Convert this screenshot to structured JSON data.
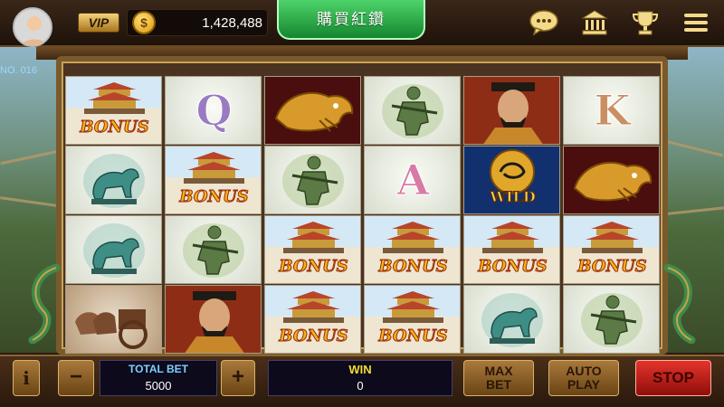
{
  "header": {
    "vip_label": "VIP",
    "coin_symbol": "$",
    "coins": "1,428,488",
    "buy_label": "購買紅鑽",
    "icons": [
      "chat-icon",
      "bank-icon",
      "trophy-icon",
      "menu-icon"
    ]
  },
  "machine": {
    "serial": "NO. 016"
  },
  "reels": [
    [
      {
        "symbol": "bonus-pagoda",
        "label": "BONUS"
      },
      {
        "symbol": "jade-qilin",
        "label": ""
      },
      {
        "symbol": "jade-qilin",
        "label": ""
      },
      {
        "symbol": "terracotta-chariot",
        "label": ""
      }
    ],
    [
      {
        "symbol": "letter-q",
        "label": "Q"
      },
      {
        "symbol": "bonus-pagoda",
        "label": "BONUS"
      },
      {
        "symbol": "jade-archer",
        "label": ""
      },
      {
        "symbol": "emperor",
        "label": ""
      }
    ],
    [
      {
        "symbol": "golden-dragon",
        "label": ""
      },
      {
        "symbol": "jade-archer",
        "label": ""
      },
      {
        "symbol": "bonus-pagoda",
        "label": "BONUS"
      },
      {
        "symbol": "bonus-pagoda",
        "label": "BONUS"
      }
    ],
    [
      {
        "symbol": "jade-archer",
        "label": ""
      },
      {
        "symbol": "letter-a",
        "label": "A"
      },
      {
        "symbol": "bonus-pagoda",
        "label": "BONUS"
      },
      {
        "symbol": "bonus-pagoda",
        "label": "BONUS"
      }
    ],
    [
      {
        "symbol": "emperor",
        "label": ""
      },
      {
        "symbol": "wild",
        "label": "WILD"
      },
      {
        "symbol": "bonus-pagoda",
        "label": "BONUS"
      },
      {
        "symbol": "jade-qilin",
        "label": ""
      }
    ],
    [
      {
        "symbol": "letter-k",
        "label": "K"
      },
      {
        "symbol": "golden-dragon",
        "label": ""
      },
      {
        "symbol": "bonus-pagoda",
        "label": "BONUS"
      },
      {
        "symbol": "jade-archer",
        "label": ""
      }
    ]
  ],
  "controls": {
    "info_label": "i",
    "minus_label": "−",
    "plus_label": "+",
    "total_bet_label": "TOTAL BET",
    "total_bet_value": "5000",
    "win_label": "WIN",
    "win_value": "0",
    "max_bet_line1": "MAX",
    "max_bet_line2": "BET",
    "auto_play_line1": "AUTO",
    "auto_play_line2": "PLAY",
    "stop_label": "STOP"
  },
  "colors": {
    "buy_button": "#2fb04a",
    "stop_button": "#c8201a",
    "bonus_text": "#f3b31c",
    "win_label": "#f3dd2e",
    "total_bet_label": "#7cd0ff"
  }
}
